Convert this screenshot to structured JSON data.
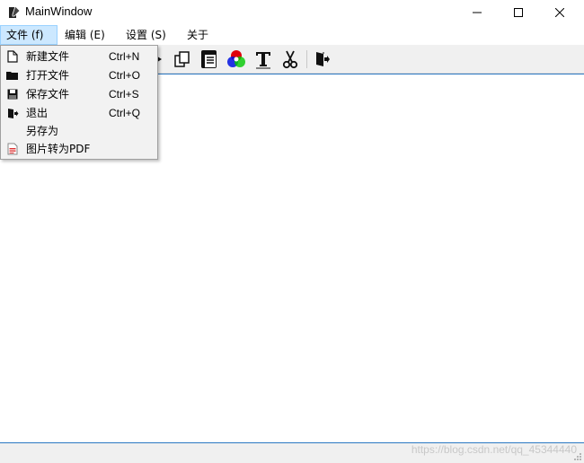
{
  "window": {
    "title": "MainWindow"
  },
  "menubar": {
    "items": [
      {
        "label": "文件 (f)"
      },
      {
        "label": "编辑 (E)"
      },
      {
        "label": "设置 (S)"
      },
      {
        "label": "关于"
      }
    ]
  },
  "file_menu": {
    "items": [
      {
        "label": "新建文件",
        "shortcut": "Ctrl+N",
        "icon": "new-file-icon"
      },
      {
        "label": "打开文件",
        "shortcut": "Ctrl+O",
        "icon": "folder-open-icon"
      },
      {
        "label": "保存文件",
        "shortcut": "Ctrl+S",
        "icon": "save-icon"
      },
      {
        "label": "退出",
        "shortcut": "Ctrl+Q",
        "icon": "exit-icon"
      },
      {
        "label": "另存为",
        "shortcut": "",
        "icon": ""
      },
      {
        "label": "图片转为PDF",
        "shortcut": "",
        "icon": "pdf-icon"
      }
    ]
  },
  "toolbar": {
    "icons": [
      "redo-icon",
      "copy-icon",
      "paste-icon",
      "color-icon",
      "font-icon",
      "cut-icon",
      "exit-icon"
    ]
  },
  "statusbar": {
    "watermark": "https://blog.csdn.net/qq_45344440"
  },
  "colors": {
    "menu_highlight": "#cce8ff",
    "border_accent": "#2b78c2"
  }
}
